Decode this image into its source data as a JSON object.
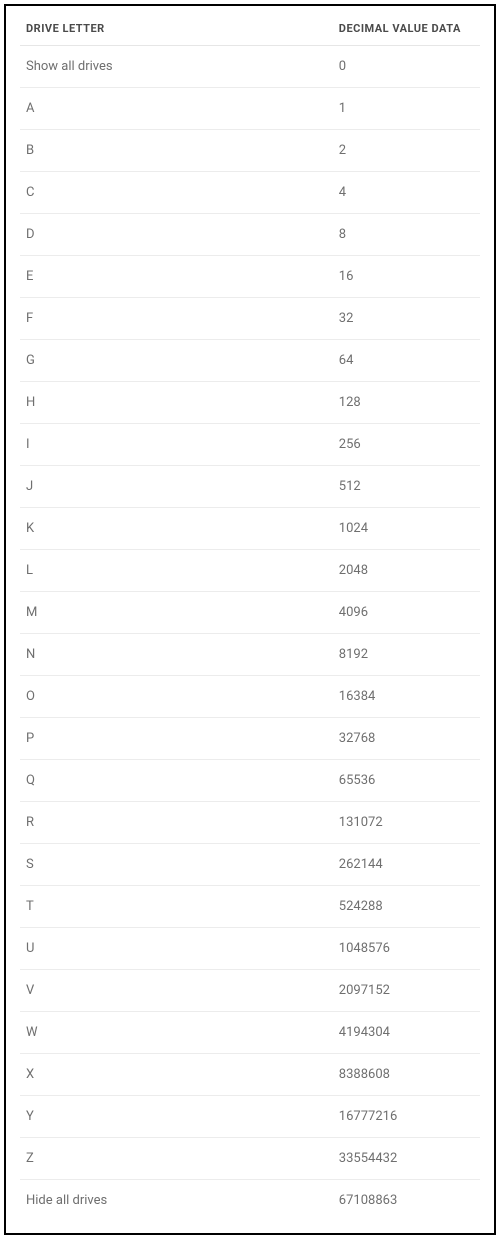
{
  "table": {
    "headers": {
      "col0": "DRIVE LETTER",
      "col1": "DECIMAL VALUE DATA"
    },
    "rows": [
      {
        "letter": "Show all drives",
        "value": "0"
      },
      {
        "letter": "A",
        "value": "1"
      },
      {
        "letter": "B",
        "value": "2"
      },
      {
        "letter": "C",
        "value": "4"
      },
      {
        "letter": "D",
        "value": "8"
      },
      {
        "letter": "E",
        "value": "16"
      },
      {
        "letter": "F",
        "value": "32"
      },
      {
        "letter": "G",
        "value": "64"
      },
      {
        "letter": "H",
        "value": "128"
      },
      {
        "letter": "I",
        "value": "256"
      },
      {
        "letter": "J",
        "value": "512"
      },
      {
        "letter": "K",
        "value": "1024"
      },
      {
        "letter": "L",
        "value": "2048"
      },
      {
        "letter": "M",
        "value": "4096"
      },
      {
        "letter": "N",
        "value": "8192"
      },
      {
        "letter": "O",
        "value": "16384"
      },
      {
        "letter": "P",
        "value": "32768"
      },
      {
        "letter": "Q",
        "value": "65536"
      },
      {
        "letter": "R",
        "value": "131072"
      },
      {
        "letter": "S",
        "value": "262144"
      },
      {
        "letter": "T",
        "value": "524288"
      },
      {
        "letter": "U",
        "value": "1048576"
      },
      {
        "letter": "V",
        "value": "2097152"
      },
      {
        "letter": "W",
        "value": "4194304"
      },
      {
        "letter": "X",
        "value": "8388608"
      },
      {
        "letter": "Y",
        "value": "16777216"
      },
      {
        "letter": "Z",
        "value": "33554432"
      },
      {
        "letter": "Hide all drives",
        "value": "67108863"
      }
    ]
  }
}
